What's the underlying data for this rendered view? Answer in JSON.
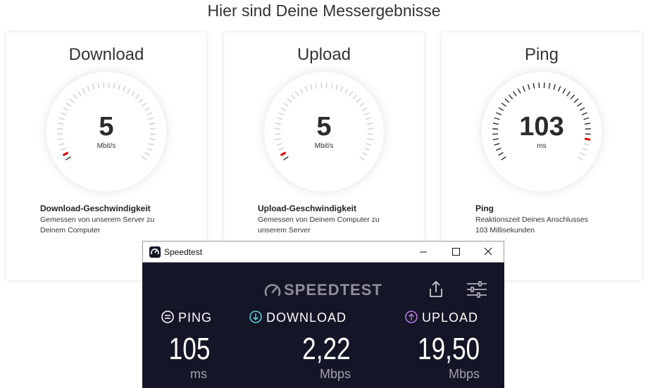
{
  "page": {
    "heading": "Hier sind Deine Messergebnisse"
  },
  "colors": {
    "accent_red": "#e60000",
    "tick_gray": "#cfcfcf",
    "tick_dark": "#2b2b2b",
    "speedtest_bg": "#141526"
  },
  "cards": [
    {
      "title": "Download",
      "value": "5",
      "unit": "Mbit/s",
      "gauge_level": 0.04,
      "desc_title": "Download-Geschwindigkeit",
      "desc_lines": [
        "Gemessen von unserem Server zu",
        "Deinem Computer"
      ]
    },
    {
      "title": "Upload",
      "value": "5",
      "unit": "Mbit/s",
      "gauge_level": 0.04,
      "desc_title": "Upload-Geschwindigkeit",
      "desc_lines": [
        "Gemessen von Deinem Computer zu",
        "unserem Server"
      ]
    },
    {
      "title": "Ping",
      "value": "103",
      "unit": "ms",
      "gauge_level": 0.9,
      "desc_title": "Ping",
      "desc_lines": [
        "Reaktionszeit Deines Anschlusses",
        "103 Millisekunden"
      ]
    }
  ],
  "speedtest": {
    "window_title": "Speedtest",
    "brand": "SPEEDTEST",
    "icons": [
      "speedtest-logo-icon",
      "share-icon",
      "settings-sliders-icon",
      "minimize-icon",
      "maximize-icon",
      "close-icon"
    ],
    "ping": {
      "label": "PING",
      "value": "105",
      "unit": "ms",
      "color": "#ffffff"
    },
    "download": {
      "label": "DOWNLOAD",
      "value": "2,22",
      "unit": "Mbps",
      "color": "#5ad0d8"
    },
    "upload": {
      "label": "UPLOAD",
      "value": "19,50",
      "unit": "Mbps",
      "color": "#b77ae0"
    }
  }
}
